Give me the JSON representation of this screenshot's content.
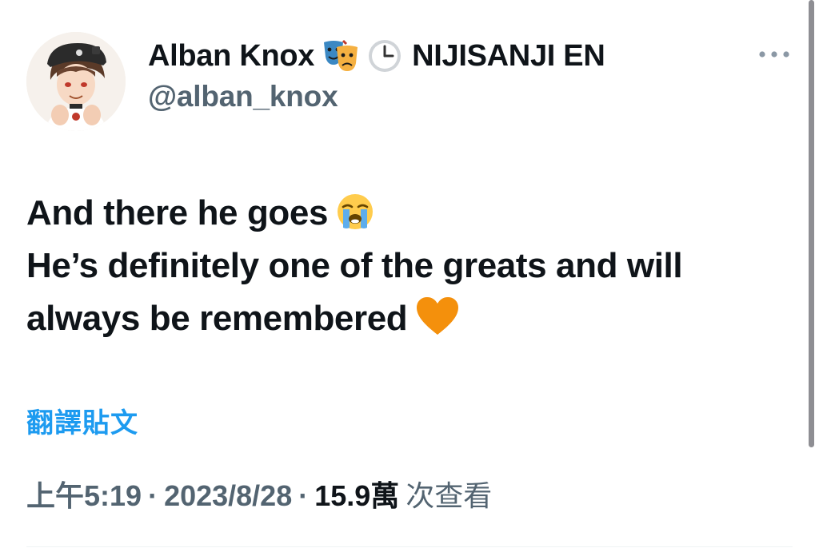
{
  "author": {
    "display_name": "Alban Knox",
    "emoji_1": "performing-arts-icon",
    "emoji_2": "clock-icon",
    "affiliation": "NIJISANJI EN",
    "handle": "@alban_knox"
  },
  "menu": {
    "icon": "more-icon"
  },
  "tweet": {
    "line1": "And there he goes",
    "line1_emoji": "loudly-crying-face-icon",
    "line2": "He’s definitely one of the greats and will",
    "line3": "always be remembered",
    "line3_emoji": "orange-heart-icon"
  },
  "translate": {
    "label": "翻譯貼文"
  },
  "meta": {
    "time": "上午5:19",
    "separator": "·",
    "date": "2023/8/28",
    "views_count": "15.9萬",
    "views_label": "次查看"
  },
  "colors": {
    "text": "#0f1419",
    "secondary": "#536471",
    "link": "#1d9bf0",
    "heart": "#f4900c"
  }
}
